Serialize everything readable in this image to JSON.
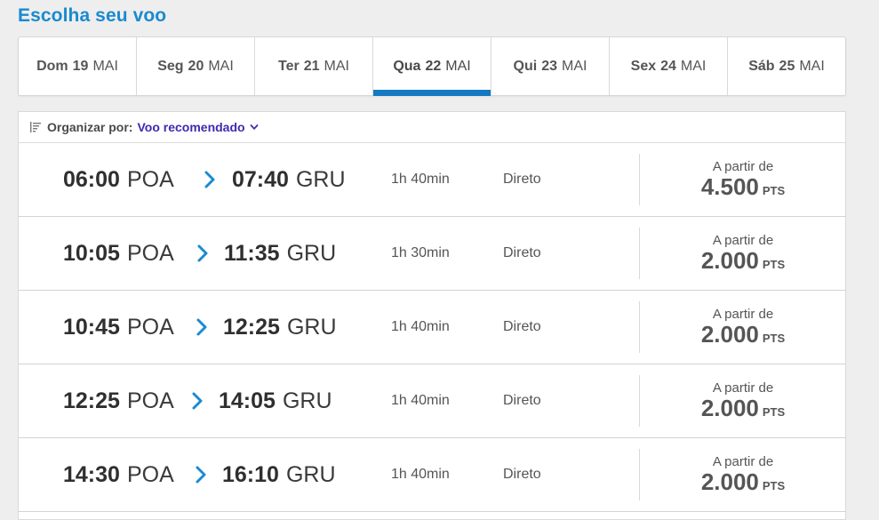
{
  "page": {
    "title": "Escolha seu voo"
  },
  "date_tabs": [
    {
      "weekday": "Dom",
      "day": "19",
      "month": "MAI",
      "active": false
    },
    {
      "weekday": "Seg",
      "day": "20",
      "month": "MAI",
      "active": false
    },
    {
      "weekday": "Ter",
      "day": "21",
      "month": "MAI",
      "active": false
    },
    {
      "weekday": "Qua",
      "day": "22",
      "month": "MAI",
      "active": true
    },
    {
      "weekday": "Qui",
      "day": "23",
      "month": "MAI",
      "active": false
    },
    {
      "weekday": "Sex",
      "day": "24",
      "month": "MAI",
      "active": false
    },
    {
      "weekday": "Sáb",
      "day": "25",
      "month": "MAI",
      "active": false
    }
  ],
  "sort": {
    "label": "Organizar por:",
    "value": "Voo recomendado",
    "icon": "sort-icon"
  },
  "flights": [
    {
      "dep_time": "06:00",
      "dep_code": "POA",
      "arr_time": "07:40",
      "arr_code": "GRU",
      "duration": "1h 40min",
      "stops": "Direto",
      "price_prefix": "A partir de",
      "price": "4.500",
      "unit": "PTS"
    },
    {
      "dep_time": "10:05",
      "dep_code": "POA",
      "arr_time": "11:35",
      "arr_code": "GRU",
      "duration": "1h 30min",
      "stops": "Direto",
      "price_prefix": "A partir de",
      "price": "2.000",
      "unit": "PTS"
    },
    {
      "dep_time": "10:45",
      "dep_code": "POA",
      "arr_time": "12:25",
      "arr_code": "GRU",
      "duration": "1h 40min",
      "stops": "Direto",
      "price_prefix": "A partir de",
      "price": "2.000",
      "unit": "PTS"
    },
    {
      "dep_time": "12:25",
      "dep_code": "POA",
      "arr_time": "14:05",
      "arr_code": "GRU",
      "duration": "1h 40min",
      "stops": "Direto",
      "price_prefix": "A partir de",
      "price": "2.000",
      "unit": "PTS"
    },
    {
      "dep_time": "14:30",
      "dep_code": "POA",
      "arr_time": "16:10",
      "arr_code": "GRU",
      "duration": "1h 40min",
      "stops": "Direto",
      "price_prefix": "A partir de",
      "price": "2.000",
      "unit": "PTS"
    }
  ],
  "colors": {
    "title": "#1a8ad0",
    "active_tab_bar": "#1479c2",
    "sort_value": "#3c2bb0",
    "arrow": "#1a8ad0"
  }
}
